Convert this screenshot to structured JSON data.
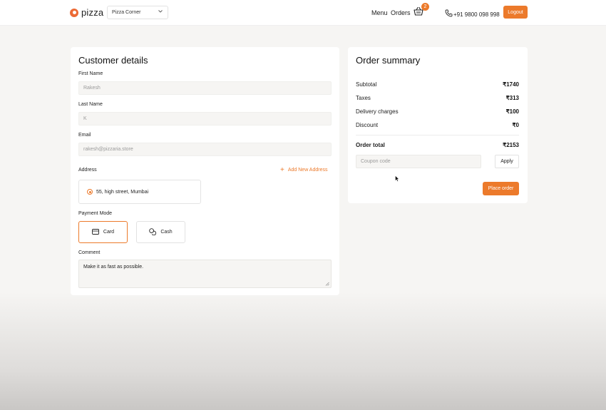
{
  "header": {
    "logo_text": "pizza",
    "store_select": "Pizza Corner",
    "nav": {
      "menu": "Menu",
      "orders": "Orders"
    },
    "cart_count": "2",
    "phone": "+91 9800 098 998",
    "logout": "Logout"
  },
  "customer": {
    "title": "Customer details",
    "first_name": {
      "label": "First Name",
      "value": "Rakesh"
    },
    "last_name": {
      "label": "Last Name",
      "value": "K"
    },
    "email": {
      "label": "Email",
      "value": "rakesh@pizzaria.store"
    },
    "address": {
      "label": "Address",
      "add_new": "Add New Address",
      "selected": "55, high street, Mumbai"
    },
    "payment": {
      "label": "Payment Mode",
      "card": "Card",
      "cash": "Cash",
      "selected": "Card"
    },
    "comment": {
      "label": "Comment",
      "value": "Make it as fast as possible."
    }
  },
  "summary": {
    "title": "Order summary",
    "rows": [
      {
        "label": "Subtotal",
        "value": "₹1740"
      },
      {
        "label": "Taxes",
        "value": "₹313"
      },
      {
        "label": "Delivery charges",
        "value": "₹100"
      },
      {
        "label": "Discount",
        "value": "₹0"
      }
    ],
    "total": {
      "label": "Order total",
      "value": "₹2153"
    },
    "coupon_placeholder": "Coupon code",
    "apply": "Apply",
    "place_order": "Place order"
  },
  "colors": {
    "accent": "#ec7a2b",
    "logo": "#ec6a35",
    "page_bg": "#f6f5f3",
    "input_bg": "#f6f5f3"
  },
  "icons": {
    "logo": "pizza-logo-icon",
    "select": "chevron-down-icon",
    "cart": "basket-icon",
    "phone": "phone-icon",
    "add": "plus-icon",
    "card": "credit-card-icon",
    "cash": "cash-coins-icon"
  }
}
